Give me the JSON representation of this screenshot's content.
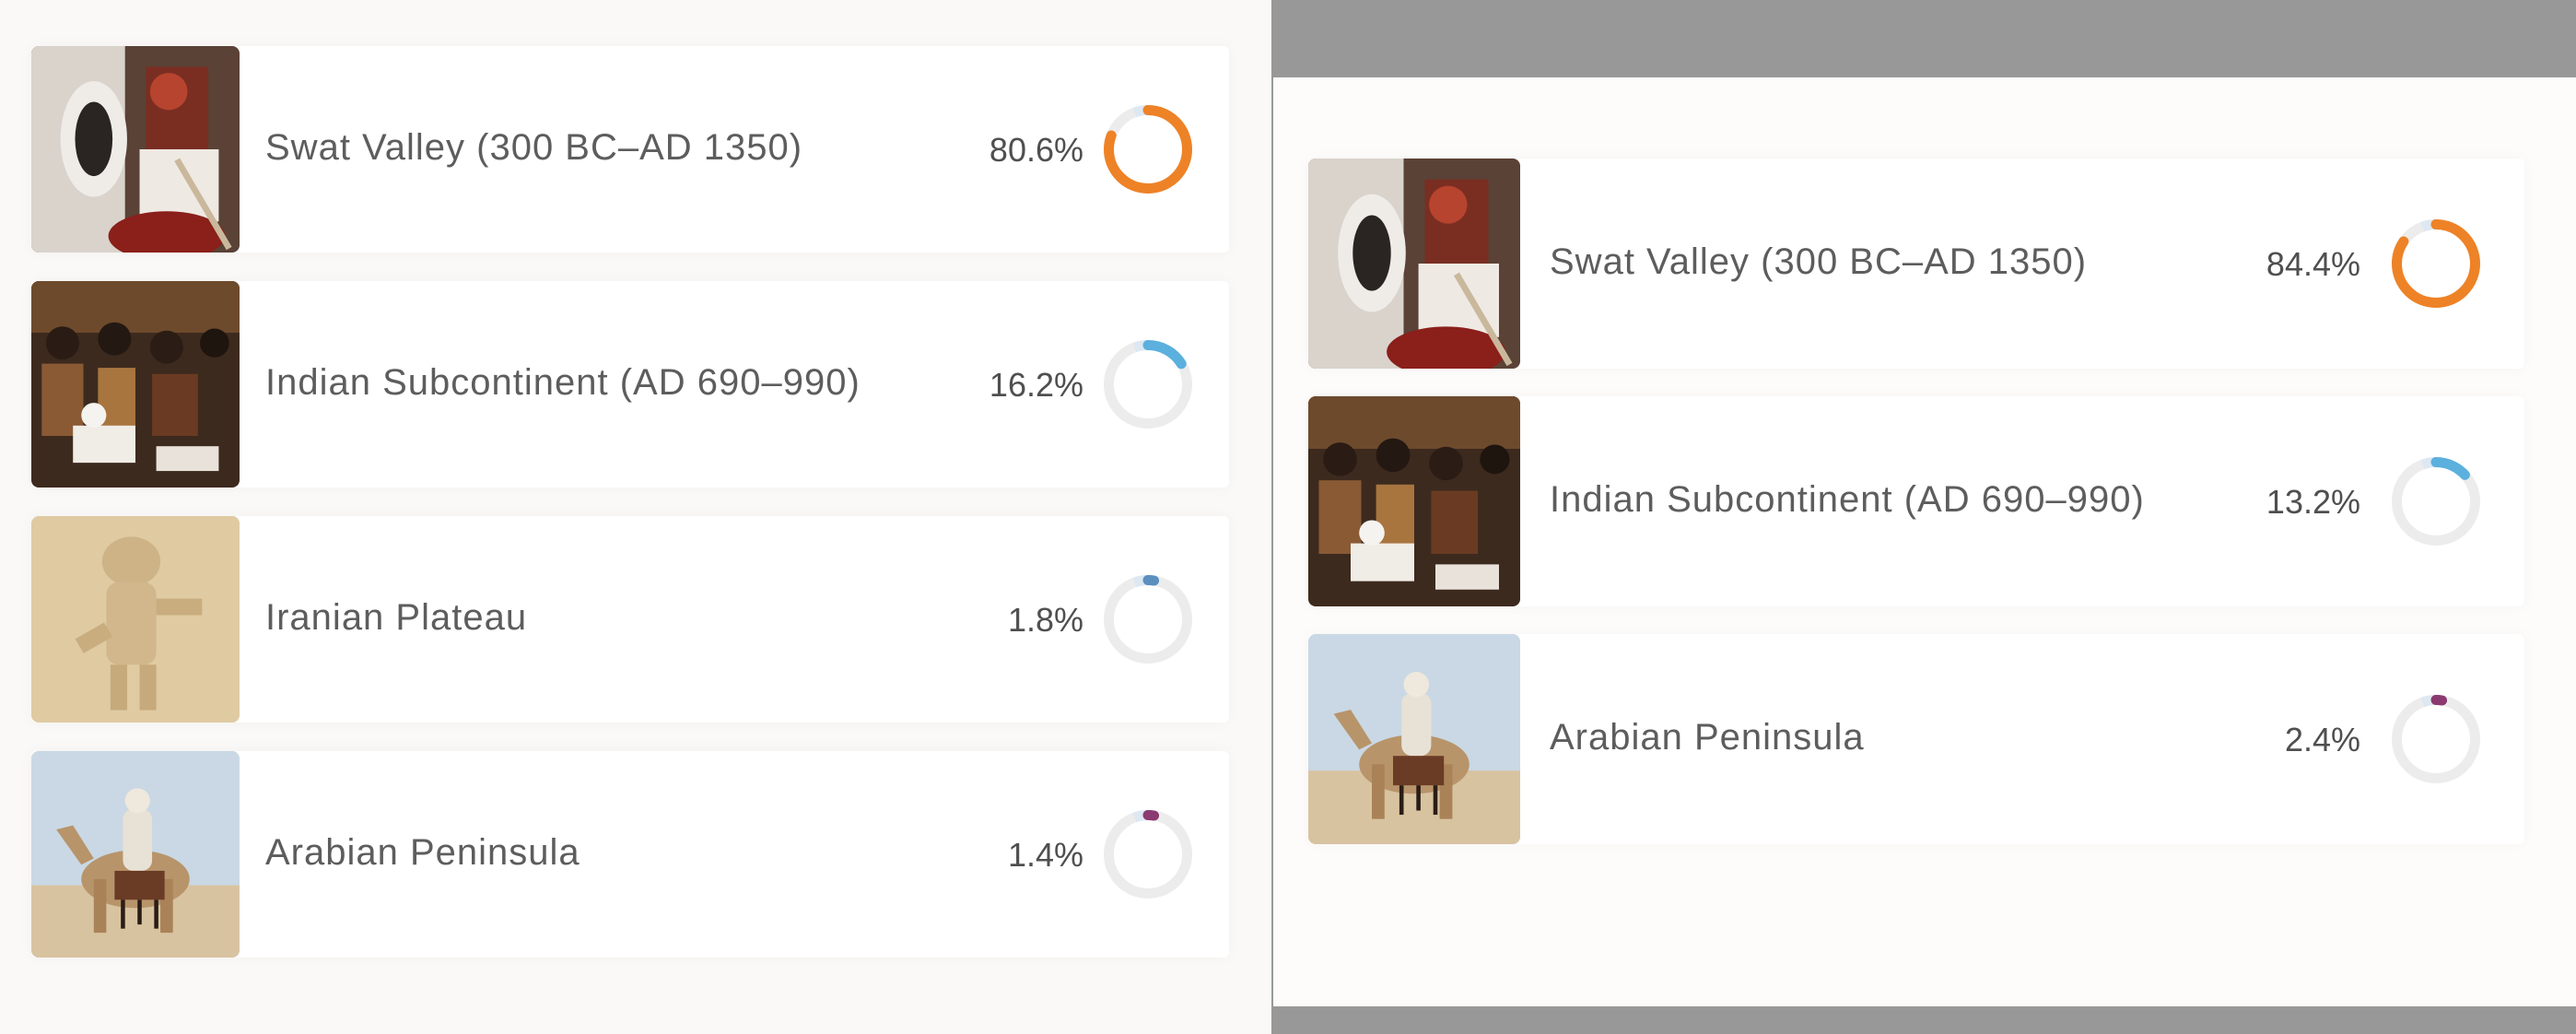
{
  "left_panel": {
    "rows": [
      {
        "label": "Swat Valley (300 BC–AD 1350)",
        "percent_text": "80.6%",
        "percent": 80.6,
        "color": "#ee8226",
        "image": "swat-valley-image"
      },
      {
        "label": "Indian Subcontinent (AD 690–990)",
        "percent_text": "16.2%",
        "percent": 16.2,
        "color": "#5bb0de",
        "image": "indian-subcontinent-image"
      },
      {
        "label": "Iranian Plateau",
        "percent_text": "1.8%",
        "percent": 1.8,
        "color": "#5b8fbd",
        "image": "iranian-plateau-image"
      },
      {
        "label": "Arabian Peninsula",
        "percent_text": "1.4%",
        "percent": 1.4,
        "color": "#8a3a70",
        "image": "arabian-peninsula-image"
      }
    ]
  },
  "right_panel": {
    "rows": [
      {
        "label": "Swat Valley (300 BC–AD 1350)",
        "percent_text": "84.4%",
        "percent": 84.4,
        "color": "#ee8226",
        "image": "swat-valley-image"
      },
      {
        "label": "Indian Subcontinent (AD 690–990)",
        "percent_text": "13.2%",
        "percent": 13.2,
        "color": "#5bb0de",
        "image": "indian-subcontinent-image"
      },
      {
        "label": "Arabian Peninsula",
        "percent_text": "2.4%",
        "percent": 2.4,
        "color": "#8a3a70",
        "image": "arabian-peninsula-image"
      }
    ]
  },
  "colors": {
    "track": "#ececec",
    "track_highlight": "#dde8f2"
  }
}
